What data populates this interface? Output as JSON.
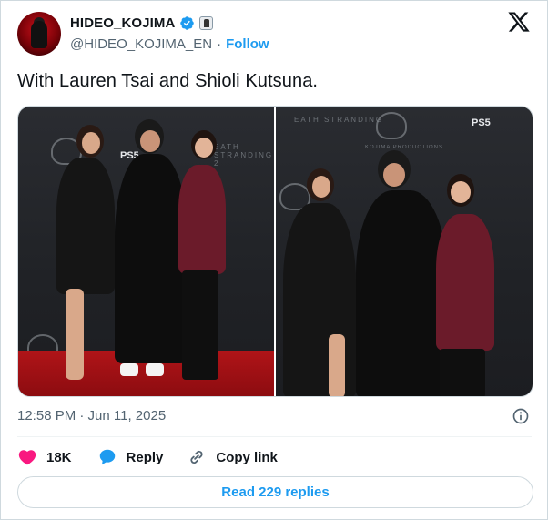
{
  "author": {
    "display_name": "HIDEO_KOJIMA",
    "handle": "@HIDEO_KOJIMA_EN",
    "follow_label": "Follow"
  },
  "tweet": {
    "text": "With Lauren Tsai and Shioli Kutsuna.",
    "timestamp": "12:58 PM · Jun 11, 2025"
  },
  "media": {
    "backdrop_text_left": "EATH STRANDING 2",
    "backdrop_text_right": "EATH STRANDING",
    "ps5_label": "PS5",
    "kojima_label": "KOJIMA PRODUCTIONS"
  },
  "actions": {
    "like_count": "18K",
    "reply_label": "Reply",
    "copy_label": "Copy link"
  },
  "replies_button": "Read 229 replies",
  "colors": {
    "accent": "#1d9bf0",
    "like": "#f91880",
    "text": "#0f1419",
    "muted": "#536471"
  }
}
